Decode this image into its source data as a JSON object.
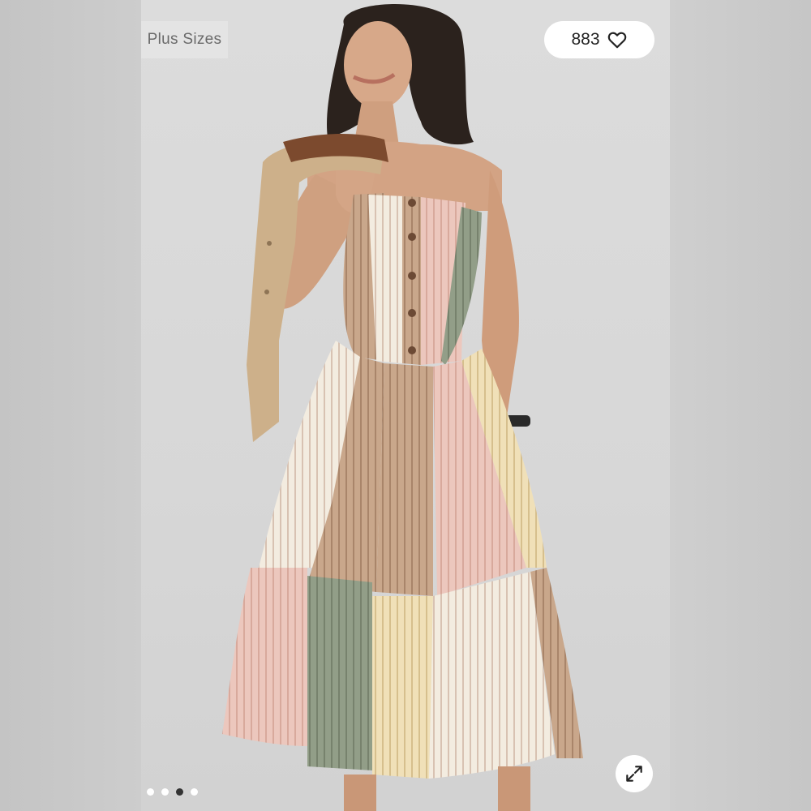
{
  "listing": {
    "category_tag": "Plus Sizes",
    "likes_count": "883",
    "like_icon": "heart-outline-icon",
    "expand_icon": "expand-arrows-icon"
  },
  "carousel": {
    "total": 4,
    "active_index": 2
  },
  "colors": {
    "pink_stripe": "#e8c2b8",
    "tan_stripe": "#c9a689",
    "sage_stripe": "#8e9a83",
    "cream_stripe": "#efe6d6",
    "yellow_stripe": "#eddcb2",
    "jacket_khaki": "#cdb08a"
  }
}
